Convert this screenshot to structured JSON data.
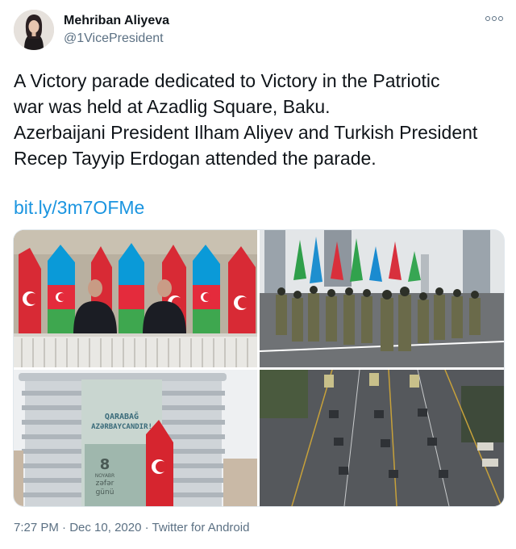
{
  "author": {
    "name": "Mehriban Aliyeva",
    "handle": "@1VicePresident"
  },
  "tweet": {
    "lines": [
      "A Victory parade dedicated to Victory in the Patriotic",
      "war was held at Azadlig Square, Baku.",
      "Azerbaijani President Ilham Aliyev and Turkish President",
      "Recep Tayyip Erdogan attended the parade."
    ],
    "link": "bit.ly/3m7OFMe"
  },
  "media": {
    "banner_line1": "QARABAĞ",
    "banner_line2": "AZƏRBAYCANDIR!",
    "banner_number": "8",
    "banner_month": "NOYABR",
    "banner_word1": "zəfər",
    "banner_word2": "günü"
  },
  "meta": {
    "time": "7:27 PM",
    "separator": "·",
    "date": "Dec 10, 2020",
    "source": "Twitter for Android"
  },
  "colors": {
    "link": "#1b95e0",
    "secondary_text": "#5b7083"
  },
  "icons": {
    "more": "more-options-icon"
  }
}
